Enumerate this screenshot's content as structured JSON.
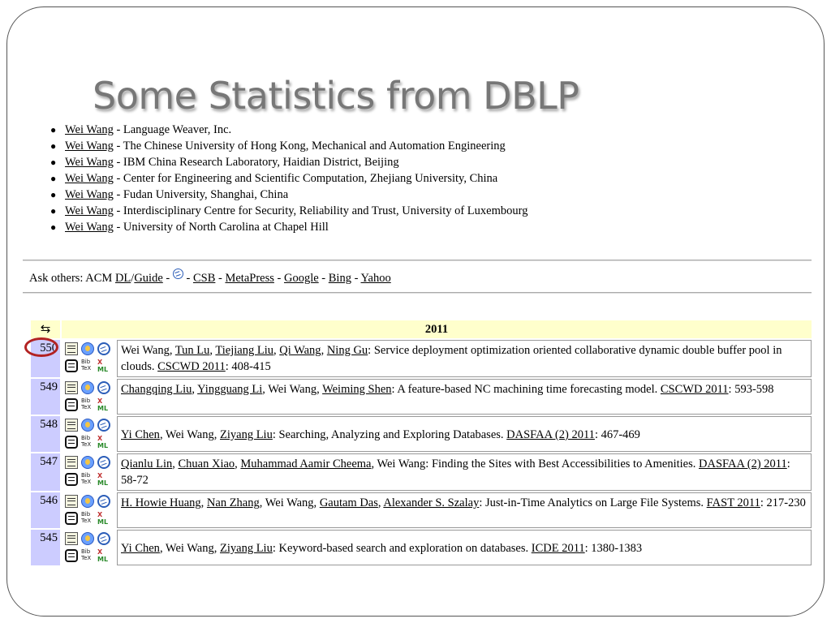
{
  "slide_title": "Some Statistics from DBLP",
  "people": [
    {
      "name": "Wei Wang",
      "affiliation": " - Language Weaver, Inc."
    },
    {
      "name": "Wei Wang",
      "affiliation": " - The Chinese University of Hong Kong, Mechanical and Automation Engineering"
    },
    {
      "name": "Wei Wang",
      "affiliation": " - IBM China Research Laboratory, Haidian District, Beijing"
    },
    {
      "name": "Wei Wang",
      "affiliation": " - Center for Engineering and Scientific Computation, Zhejiang University, China"
    },
    {
      "name": "Wei Wang",
      "affiliation": " - Fudan University, Shanghai, China"
    },
    {
      "name": "Wei Wang",
      "affiliation": " - Interdisciplinary Centre for Security, Reliability and Trust, University of Luxembourg"
    },
    {
      "name": "Wei Wang",
      "affiliation": " - University of North Carolina at Chapel Hill"
    }
  ],
  "ask_others": {
    "prefix": "Ask others: ACM ",
    "dl": "DL",
    "guide": "Guide",
    "csb": "CSB",
    "metapress": "MetaPress",
    "google": "Google",
    "bing": "Bing",
    "yahoo": "Yahoo"
  },
  "year_header": "2011",
  "icon_names": [
    "sort-icon",
    "document-icon",
    "reviewer-icon",
    "google-scholar-icon",
    "citeseer-icon",
    "bibtex-icon",
    "xml-icon"
  ],
  "accent_colors": {
    "number_cell": "#ccccff",
    "year_header": "#ffffcc",
    "highlight_circle": "#b22222"
  },
  "publications": [
    {
      "number": "550",
      "authors": [
        {
          "t": "Wei Wang",
          "link": false
        },
        {
          "t": ", ",
          "link": false
        },
        {
          "t": "Tun Lu",
          "link": true
        },
        {
          "t": ", ",
          "link": false
        },
        {
          "t": "Tiejiang Liu",
          "link": true
        },
        {
          "t": ", ",
          "link": false
        },
        {
          "t": "Qi Wang",
          "link": true
        },
        {
          "t": ", ",
          "link": false
        },
        {
          "t": "Ning Gu",
          "link": true
        }
      ],
      "title": ": Service deployment optimization oriented collaborative dynamic double buffer pool in clouds. ",
      "venue": "CSCWD 2011",
      "pages": ": 408-415"
    },
    {
      "number": "549",
      "authors": [
        {
          "t": "Changqing Liu",
          "link": true
        },
        {
          "t": ", ",
          "link": false
        },
        {
          "t": "Yingguang Li",
          "link": true
        },
        {
          "t": ", Wei Wang, ",
          "link": false
        },
        {
          "t": "Weiming Shen",
          "link": true
        }
      ],
      "title": ": A feature-based NC machining time forecasting model. ",
      "venue": "CSCWD 2011",
      "pages": ": 593-598"
    },
    {
      "number": "548",
      "authors": [
        {
          "t": "Yi Chen",
          "link": true
        },
        {
          "t": ", Wei Wang, ",
          "link": false
        },
        {
          "t": "Ziyang Liu",
          "link": true
        }
      ],
      "title": ": Searching, Analyzing and Exploring Databases. ",
      "venue": "DASFAA (2) 2011",
      "pages": ": 467-469"
    },
    {
      "number": "547",
      "authors": [
        {
          "t": "Qianlu Lin",
          "link": true
        },
        {
          "t": ", ",
          "link": false
        },
        {
          "t": "Chuan Xiao",
          "link": true
        },
        {
          "t": ", ",
          "link": false
        },
        {
          "t": "Muhammad Aamir Cheema",
          "link": true
        },
        {
          "t": ", Wei Wang",
          "link": false
        }
      ],
      "title": ": Finding the Sites with Best Accessibilities to Amenities. ",
      "venue": "DASFAA (2) 2011",
      "pages": ": 58-72"
    },
    {
      "number": "546",
      "authors": [
        {
          "t": "H. Howie Huang",
          "link": true
        },
        {
          "t": ", ",
          "link": false
        },
        {
          "t": "Nan Zhang",
          "link": true
        },
        {
          "t": ", Wei Wang, ",
          "link": false
        },
        {
          "t": "Gautam Das",
          "link": true
        },
        {
          "t": ", ",
          "link": false
        },
        {
          "t": "Alexander S. Szalay",
          "link": true
        }
      ],
      "title": ": Just-in-Time Analytics on Large File Systems. ",
      "venue": "FAST 2011",
      "pages": ": 217-230"
    },
    {
      "number": "545",
      "authors": [
        {
          "t": "Yi Chen",
          "link": true
        },
        {
          "t": ", Wei Wang, ",
          "link": false
        },
        {
          "t": "Ziyang Liu",
          "link": true
        }
      ],
      "title": ": Keyword-based search and exploration on databases. ",
      "venue": "ICDE 2011",
      "pages": ": 1380-1383"
    }
  ]
}
